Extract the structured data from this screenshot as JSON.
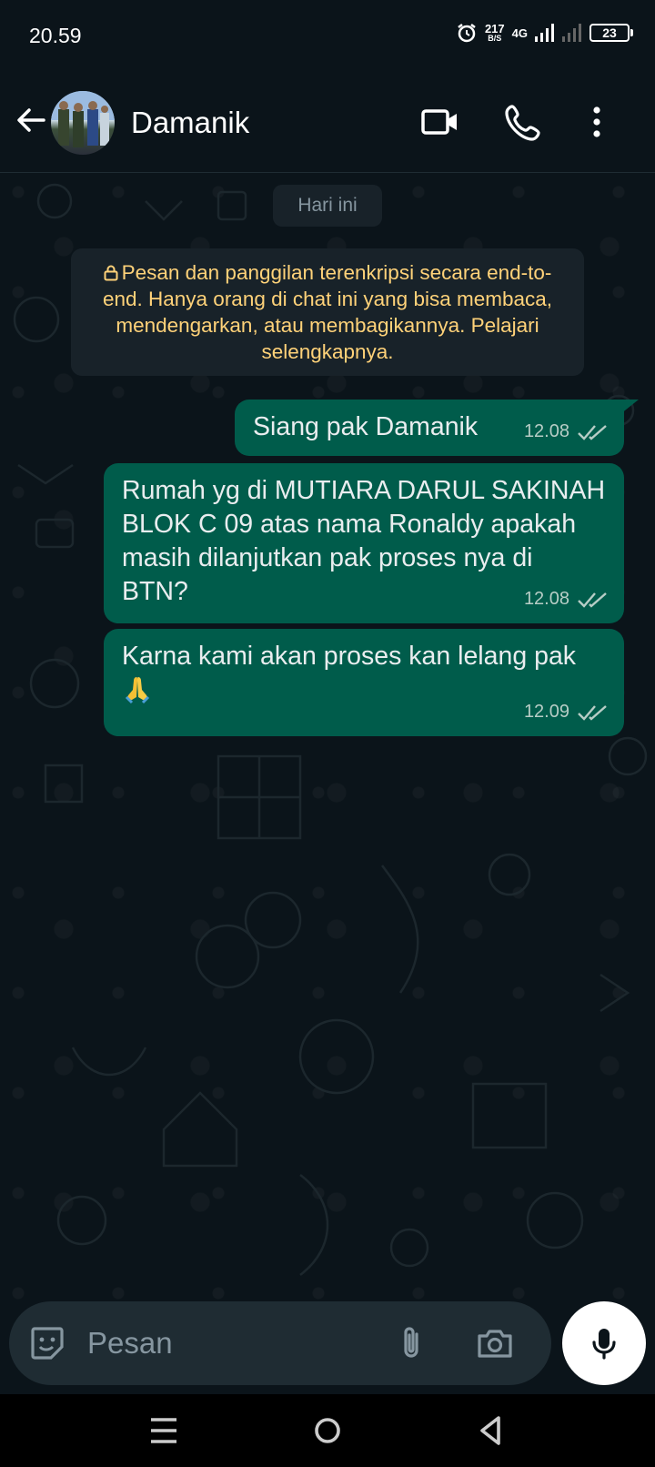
{
  "status_bar": {
    "time": "20.59",
    "net_speed": "217",
    "net_unit": "B/S",
    "network": "4G",
    "battery": "23"
  },
  "header": {
    "contact_name": "Damanik"
  },
  "chat": {
    "date_label": "Hari ini",
    "notice": "Pesan dan panggilan terenkripsi secara end-to-end. Hanya orang di chat ini yang bisa membaca, mendengarkan, atau membagikannya. Pelajari selengkapnya.",
    "messages": [
      {
        "text": "Siang pak Damanik",
        "time": "12.08",
        "status": "read"
      },
      {
        "text": "Rumah yg di MUTIARA DARUL SAKINAH BLOK C 09 atas nama Ronaldy apakah masih dilanjutkan pak proses nya di BTN?",
        "time": "12.08",
        "status": "read"
      },
      {
        "text": "Karna kami akan proses kan lelang pak",
        "time": "12.09",
        "status": "read",
        "emoji": "folded-hands"
      }
    ]
  },
  "composer": {
    "placeholder": "Pesan"
  },
  "colors": {
    "outgoing_bubble": "#005c4b",
    "background": "#0b141a",
    "notice_text": "#ffd279"
  }
}
